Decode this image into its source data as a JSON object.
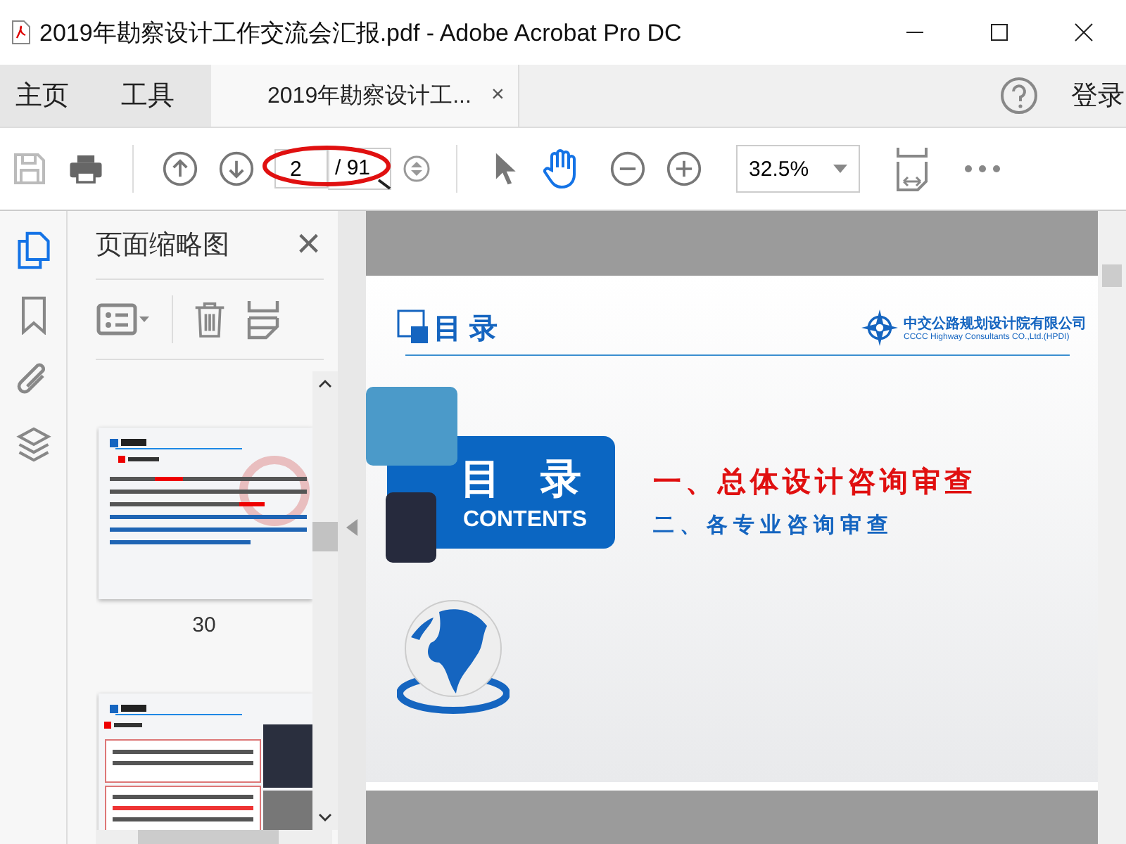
{
  "window": {
    "title": "2019年勘察设计工作交流会汇报.pdf - Adobe Acrobat Pro DC"
  },
  "tabs": [
    {
      "label": "主页",
      "kind": "menu",
      "selected": false
    },
    {
      "label": "工具",
      "kind": "menu",
      "selected": false
    },
    {
      "label": "2019年勘察设计工...",
      "kind": "document",
      "selected": true,
      "close": "×"
    }
  ],
  "account": {
    "label": "登录"
  },
  "toolbar": {
    "page": "2",
    "page_count": "/ 91",
    "zoom": "32.5%"
  },
  "rail": [
    {
      "kind": "pages",
      "selected": true
    },
    {
      "kind": "bookmark",
      "selected": false
    },
    {
      "kind": "attachment",
      "selected": false
    },
    {
      "kind": "layers",
      "selected": false
    }
  ],
  "thumbnails_panel": {
    "title": "页面缩略图",
    "close": "×",
    "thumbnails": [
      {
        "kind": "text",
        "label": "30"
      },
      {
        "kind": "photo"
      }
    ]
  },
  "document": {
    "header_title": "目 录",
    "logo_name": "中交公路规划设计院有限公司",
    "logo_subtitle": "CCCC Highway Consultants CO.,Ltd.(HPDI)",
    "box_title": "目 录",
    "box_subtitle": "CONTENTS",
    "items": [
      {
        "text": "一、总体设计咨询审查",
        "active": true
      },
      {
        "text": "二、各专业咨询审查",
        "active": false
      }
    ]
  }
}
